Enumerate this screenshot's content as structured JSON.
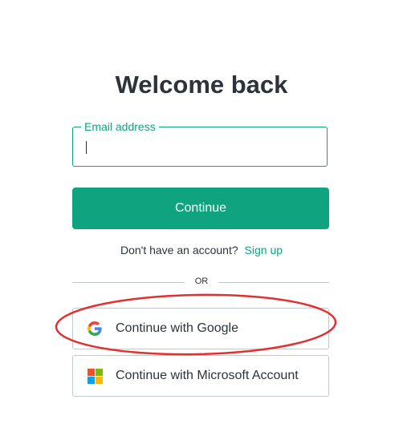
{
  "page": {
    "title": "Welcome back"
  },
  "email": {
    "label": "Email address",
    "value": ""
  },
  "continue_label": "Continue",
  "signup": {
    "prompt": "Don't have an account?",
    "link": "Sign up"
  },
  "divider_text": "OR",
  "social": {
    "google_label": "Continue with Google",
    "microsoft_label": "Continue with Microsoft Account"
  },
  "colors": {
    "accent": "#10a37f",
    "text": "#2d333a",
    "border": "#c2c8d0",
    "annotation": "#e03131"
  },
  "icons": [
    "google-icon",
    "microsoft-icon"
  ]
}
